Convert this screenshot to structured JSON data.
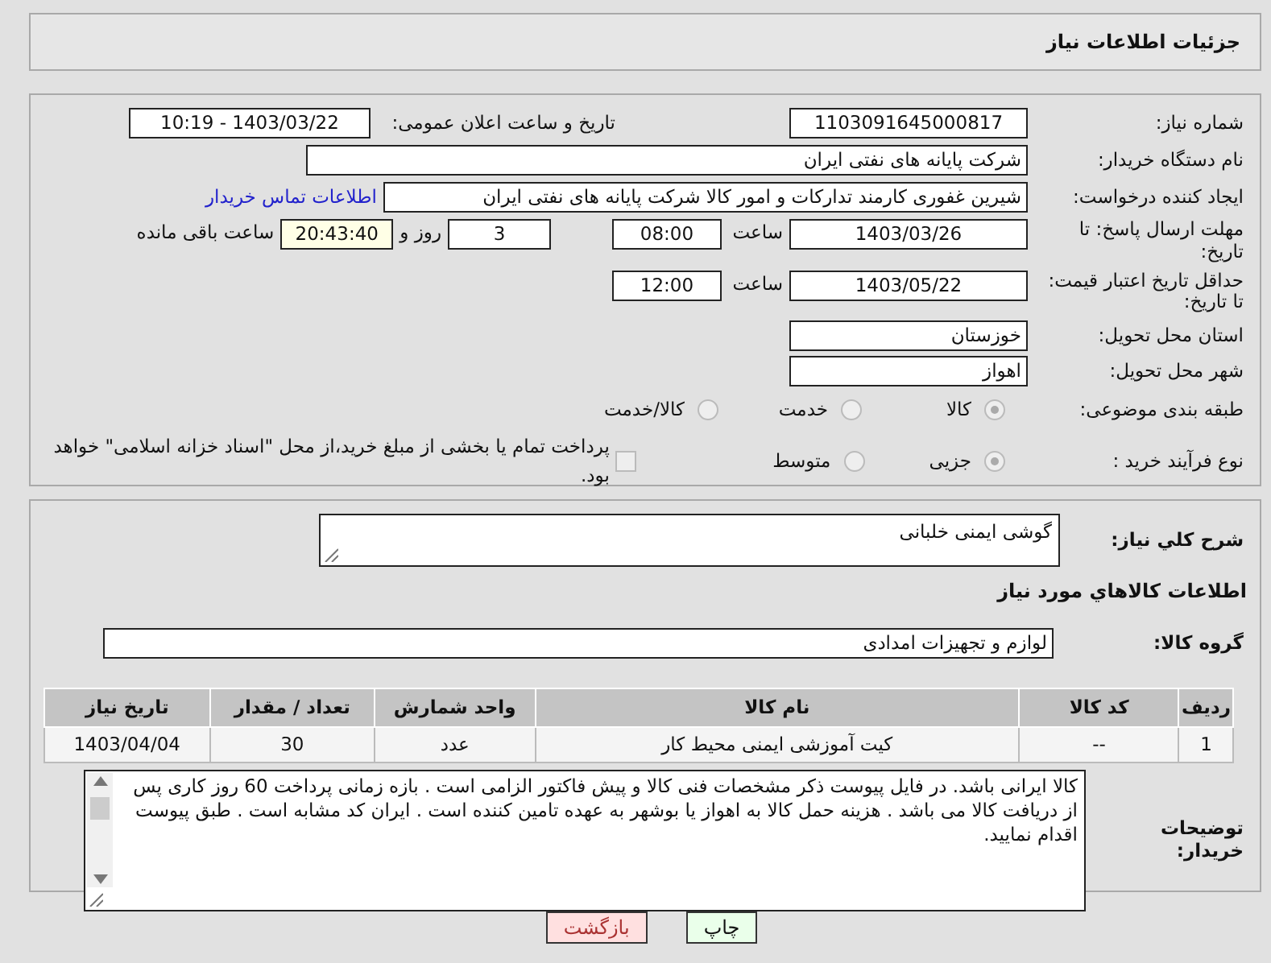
{
  "header": {
    "title": "جزئیات اطلاعات نیاز"
  },
  "need_number": {
    "label": "شماره نیاز:",
    "value": "1103091645000817"
  },
  "announce": {
    "label": "تاریخ و ساعت اعلان عمومی:",
    "value": "1403/03/22 - 10:19"
  },
  "buyer_org": {
    "label": "نام دستگاه خریدار:",
    "value": "شرکت پایانه های نفتی ایران"
  },
  "requester": {
    "label": "ایجاد کننده درخواست:",
    "value": "شیرین غفوری کارمند تدارکات و امور کالا شرکت پایانه های نفتی ایران",
    "link": "اطلاعات تماس خریدار"
  },
  "response_deadline": {
    "label": "مهلت ارسال پاسخ: تا تاریخ:",
    "date": "1403/03/26",
    "time_label": "ساعت",
    "time": "08:00",
    "days": "3",
    "days_label": "روز و",
    "remaining": "20:43:40",
    "remaining_label": "ساعت باقی مانده"
  },
  "price_validity": {
    "label": "حداقل تاریخ اعتبار قیمت: تا تاریخ:",
    "date": "1403/05/22",
    "time_label": "ساعت",
    "time": "12:00"
  },
  "province": {
    "label": "استان محل تحویل:",
    "value": "خوزستان"
  },
  "city": {
    "label": "شهر محل تحویل:",
    "value": "اهواز"
  },
  "category": {
    "label": "طبقه بندی موضوعی:",
    "options": [
      {
        "label": "کالا",
        "selected": true
      },
      {
        "label": "خدمت",
        "selected": false
      },
      {
        "label": "کالا/خدمت",
        "selected": false
      }
    ]
  },
  "process": {
    "label": "نوع فرآیند خرید :",
    "options": [
      {
        "label": "جزیی",
        "selected": true
      },
      {
        "label": "متوسط",
        "selected": false
      }
    ],
    "payment_note": {
      "label": "پرداخت تمام یا بخشی از مبلغ خرید،از محل \"اسناد خزانه اسلامی\" خواهد بود.",
      "checked": false
    }
  },
  "description": {
    "label": "شرح کلي نياز:",
    "value": "گوشی ایمنی خلبانی"
  },
  "goods_heading": "اطلاعات کالاهاي مورد نياز",
  "goods_group": {
    "label": "گروه کالا:",
    "value": "لوازم و تجهیزات امدادی"
  },
  "table": {
    "columns": [
      "ردیف",
      "کد کالا",
      "نام کالا",
      "واحد شمارش",
      "تعداد / مقدار",
      "تاریخ نیاز"
    ],
    "rows": [
      [
        "1",
        "--",
        "کیت آموزشی ایمنی محیط کار",
        "عدد",
        "30",
        "1403/04/04"
      ]
    ]
  },
  "buyer_notes": {
    "label": "توضیحات خریدار:",
    "value": "کالا ایرانی باشد. در فایل پیوست ذکر مشخصات فنی کالا و پیش فاکتور الزامی است . بازه زمانی پرداخت 60 روز کاری پس از دریافت کالا می باشد . هزینه حمل کالا به اهواز یا بوشهر به عهده تامین کننده است . ایران کد مشابه است . طبق پیوست اقدام نمایید."
  },
  "buttons": [
    {
      "label": "چاپ",
      "kind": "print"
    },
    {
      "label": "بازگشت",
      "kind": "back"
    }
  ]
}
